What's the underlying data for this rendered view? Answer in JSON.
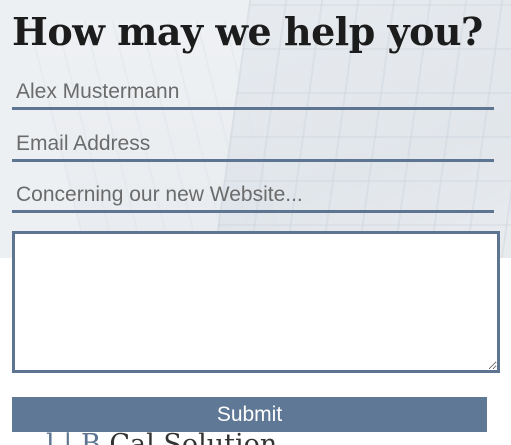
{
  "hero": {
    "title": "How may we help you?"
  },
  "form": {
    "name_placeholder": "Alex Mustermann",
    "email_placeholder": "Email Address",
    "subject_placeholder": "Concerning our new Website...",
    "message_value": "",
    "submit_label": "Submit"
  },
  "footer": {
    "partial_prefix": "l | B",
    "partial_text": "Cal    Solution"
  },
  "colors": {
    "accent": "#5e7591",
    "button": "#5f7896",
    "title": "#1c1c1c"
  }
}
